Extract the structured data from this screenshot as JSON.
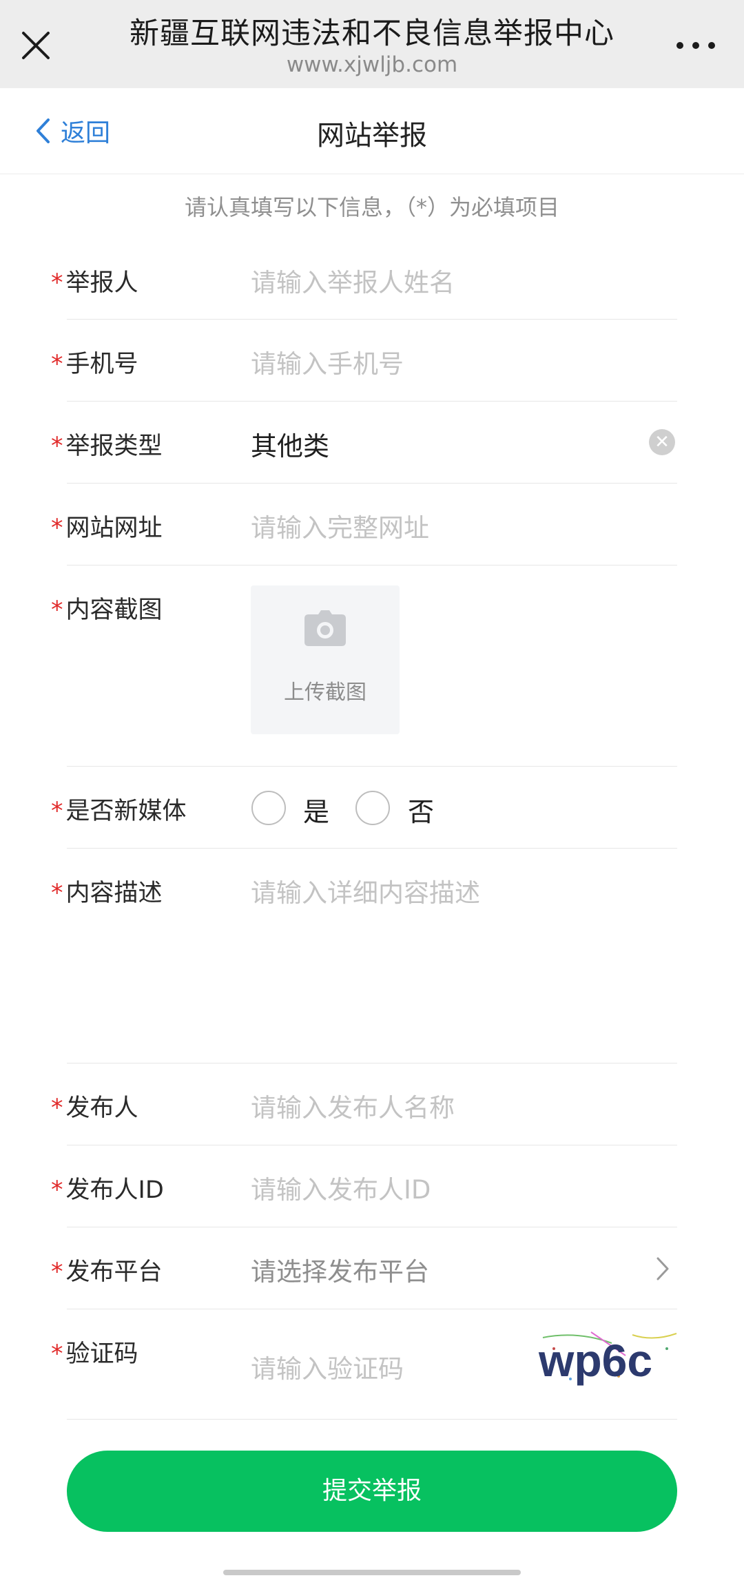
{
  "window": {
    "title": "新疆互联网违法和不良信息举报中心",
    "url": "www.xjwljb.com"
  },
  "nav": {
    "back_label": "返回",
    "title": "网站举报"
  },
  "form": {
    "hint": "请认真填写以下信息，（*）为必填项目",
    "required_mark": "*",
    "fields": {
      "reporter": {
        "label": "举报人",
        "placeholder": "请输入举报人姓名"
      },
      "phone": {
        "label": "手机号",
        "placeholder": "请输入手机号"
      },
      "report_type": {
        "label": "举报类型",
        "value": "其他类"
      },
      "website_url": {
        "label": "网站网址",
        "placeholder": "请输入完整网址"
      },
      "screenshot": {
        "label": "内容截图",
        "upload_label": "上传截图"
      },
      "new_media": {
        "label": "是否新媒体",
        "options": [
          "是",
          "否"
        ],
        "selected": null
      },
      "description": {
        "label": "内容描述",
        "placeholder": "请输入详细内容描述"
      },
      "publisher": {
        "label": "发布人",
        "placeholder": "请输入发布人名称"
      },
      "publisher_id": {
        "label": "发布人ID",
        "placeholder": "请输入发布人ID"
      },
      "platform": {
        "label": "发布平台",
        "placeholder": "请选择发布平台"
      },
      "captcha": {
        "label": "验证码",
        "placeholder": "请输入验证码",
        "image_text": "wp6c"
      }
    },
    "submit_label": "提交举报"
  },
  "colors": {
    "accent": "#07c160",
    "link": "#2f80d8",
    "required": "#e12b2b"
  }
}
